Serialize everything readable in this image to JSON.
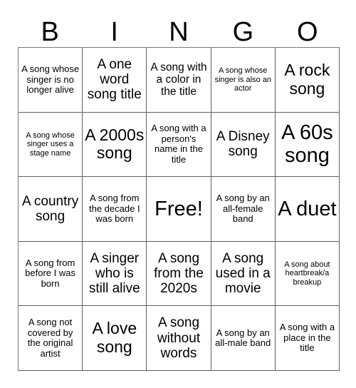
{
  "card": {
    "title": "BINGO",
    "header_letters": [
      "B",
      "I",
      "N",
      "G",
      "O"
    ],
    "free_space_label": "Free!",
    "rows": 5,
    "columns": 5,
    "colors": {
      "background": "#ffffff",
      "cell_background": "#ffffff",
      "border": "#5f5f5f",
      "text": "#000000"
    },
    "cells": [
      [
        {
          "text": "A song whose singer is no longer alive",
          "size": "sm"
        },
        {
          "text": "A one word song title",
          "size": "lg"
        },
        {
          "text": "A song with a color in the title",
          "size": "md"
        },
        {
          "text": "A song whose singer is also an actor",
          "size": "xs"
        },
        {
          "text": "A rock song",
          "size": "xl"
        }
      ],
      [
        {
          "text": "A song whose singer uses a stage name",
          "size": "xs"
        },
        {
          "text": "A 2000s song",
          "size": "xl"
        },
        {
          "text": "A song with a person's name in the title",
          "size": "sm"
        },
        {
          "text": "A Disney song",
          "size": "lg"
        },
        {
          "text": "A 60s song",
          "size": "xxl"
        }
      ],
      [
        {
          "text": "A country song",
          "size": "lg"
        },
        {
          "text": "A song from the decade I was born",
          "size": "sm"
        },
        {
          "text": "Free!",
          "size": "xxl"
        },
        {
          "text": "A song by an all-female band",
          "size": "sm"
        },
        {
          "text": "A duet",
          "size": "xxl"
        }
      ],
      [
        {
          "text": "A song from before I was born",
          "size": "sm"
        },
        {
          "text": "A singer who is still alive",
          "size": "lg"
        },
        {
          "text": "A song from the 2020s",
          "size": "lg"
        },
        {
          "text": "A song used in a movie",
          "size": "lg"
        },
        {
          "text": "A song about heartbreak/a breakup",
          "size": "xs"
        }
      ],
      [
        {
          "text": "A song not covered by the original artist",
          "size": "sm"
        },
        {
          "text": "A love song",
          "size": "xl"
        },
        {
          "text": "A song without words",
          "size": "lg"
        },
        {
          "text": "A song by an all-male band",
          "size": "sm"
        },
        {
          "text": "A song with a place in the title",
          "size": "sm"
        }
      ]
    ]
  }
}
